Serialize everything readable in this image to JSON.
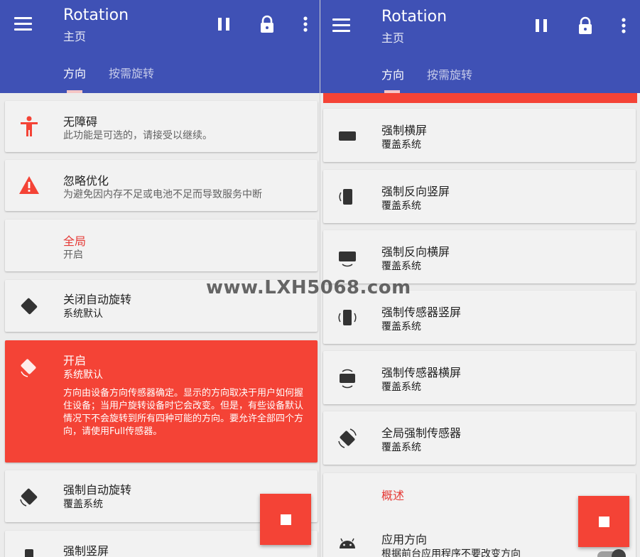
{
  "colors": {
    "primary": "#3f51b5",
    "accent": "#f44336",
    "background": "#ececec",
    "card": "#f2f2f2"
  },
  "left": {
    "appbar": {
      "title": "Rotation",
      "subtitle": "主页",
      "tabs": [
        "方向",
        "按需旋转"
      ],
      "actions": [
        "pause-icon",
        "lock-icon",
        "more-vert-icon"
      ]
    },
    "cards": [
      {
        "title": "无障碍",
        "subtitle": "此功能是可选的，请接受以继续。",
        "icon": "accessibility-icon"
      },
      {
        "title": "忽略优化",
        "subtitle": "为避免因内存不足或电池不足而导致服务中断",
        "icon": "warning-icon"
      },
      {
        "title": "全局",
        "subtitle": "开启",
        "section": true
      },
      {
        "title": "关闭自动旋转",
        "subtitle": "系统默认",
        "icon": "rotation-lock-icon"
      },
      {
        "title": "开启",
        "subtitle": "系统默认",
        "description": "方向由设备方向传感器确定。显示的方向取决于用户如何握住设备；当用户旋转设备时它会改变。但是，有些设备默认情况下不会旋转到所有四种可能的方向。要允许全部四个方向，请使用Full传感器。",
        "icon": "auto-rotate-icon",
        "selected": true
      },
      {
        "title": "强制自动旋转",
        "subtitle": "覆盖系统",
        "icon": "force-rotate-icon"
      },
      {
        "title": "强制竖屏",
        "subtitle": "",
        "icon": "portrait-icon"
      }
    ]
  },
  "right": {
    "appbar": {
      "title": "Rotation",
      "subtitle": "主页",
      "tabs": [
        "方向",
        "按需旋转"
      ],
      "actions": [
        "pause-icon",
        "lock-icon",
        "more-vert-icon"
      ]
    },
    "cards": [
      {
        "title": "强制横屏",
        "subtitle": "覆盖系统",
        "icon": "landscape-icon"
      },
      {
        "title": "强制反向竖屏",
        "subtitle": "覆盖系统",
        "icon": "reverse-portrait-icon"
      },
      {
        "title": "强制反向横屏",
        "subtitle": "覆盖系统",
        "icon": "reverse-landscape-icon"
      },
      {
        "title": "强制传感器竖屏",
        "subtitle": "覆盖系统",
        "icon": "sensor-portrait-icon"
      },
      {
        "title": "强制传感器横屏",
        "subtitle": "覆盖系统",
        "icon": "sensor-landscape-icon"
      },
      {
        "title": "全局强制传感器",
        "subtitle": "覆盖系统",
        "icon": "full-sensor-icon"
      },
      {
        "section_title": "概述",
        "title": "应用方向",
        "subtitle": "根据前台应用程序不要改变方向",
        "icon": "android-icon",
        "toggle": "on"
      }
    ]
  },
  "watermark": "www.LXH5068.com"
}
